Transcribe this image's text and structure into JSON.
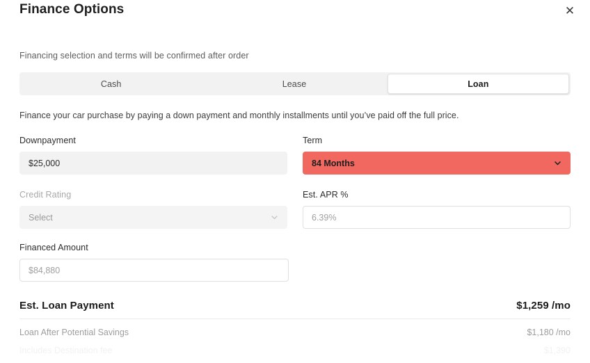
{
  "header": {
    "title": "Finance Options",
    "close_label": "✕"
  },
  "body": {
    "confirm_note": "Financing selection and terms will be confirmed after order",
    "description": "Finance your car purchase by paying a down payment and monthly installments until you’ve paid off the full price."
  },
  "tabs": [
    {
      "label": "Cash",
      "active": false
    },
    {
      "label": "Lease",
      "active": false
    },
    {
      "label": "Loan",
      "active": true
    }
  ],
  "fields": {
    "downpayment": {
      "label": "Downpayment",
      "value": "$25,000"
    },
    "term": {
      "label": "Term",
      "value": "84 Months"
    },
    "credit_rating": {
      "label": "Credit Rating",
      "placeholder": "Select"
    },
    "est_apr": {
      "label": "Est. APR %",
      "placeholder": "6.39%"
    },
    "financed_amount": {
      "label": "Financed Amount",
      "placeholder": "$84,880"
    }
  },
  "summary": {
    "primary": {
      "label": "Est. Loan Payment",
      "value": "$1,259 /mo"
    },
    "savings": {
      "label": "Loan After Potential Savings",
      "value": "$1,180 /mo"
    },
    "destination": {
      "label": "Includes Destination fee",
      "value": "$1,390"
    }
  },
  "colors": {
    "highlight": "#f0685f",
    "track": "#f2f2f2",
    "text": "#2a2a2a"
  }
}
